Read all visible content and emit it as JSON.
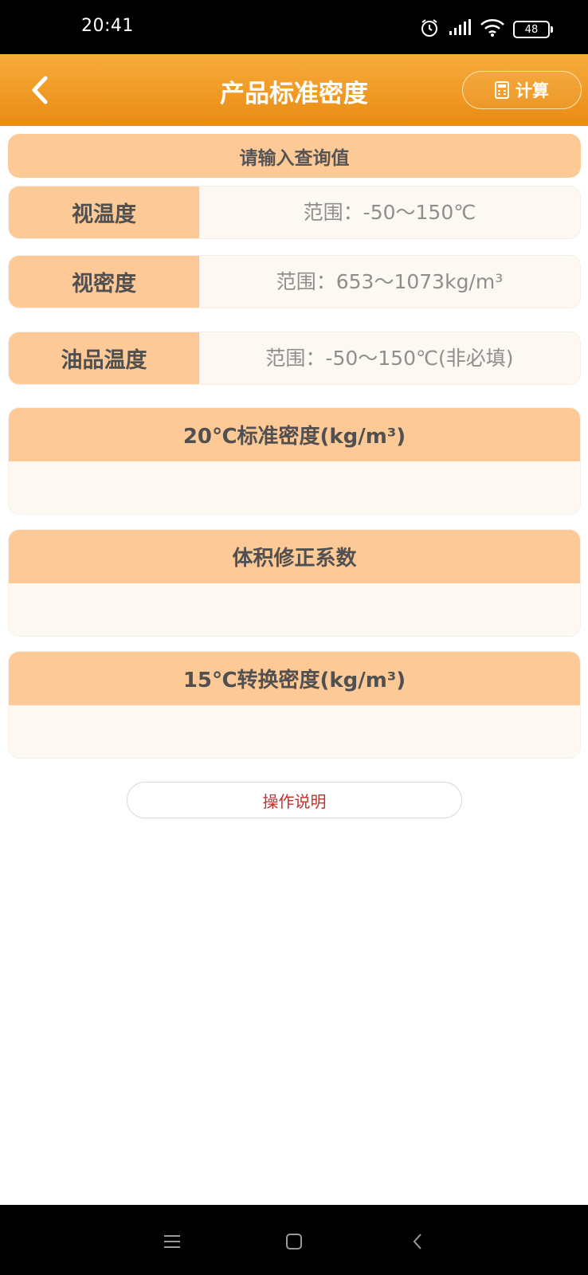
{
  "status": {
    "time": "20:41",
    "battery": "48"
  },
  "header": {
    "title": "产品标准密度",
    "calc_label": "计算"
  },
  "query": {
    "title": "请输入查询值"
  },
  "inputs": [
    {
      "label": "视温度",
      "placeholder": "范围：-50～150℃",
      "value": ""
    },
    {
      "label": "视密度",
      "placeholder": "范围：653～1073kg/m³",
      "value": ""
    },
    {
      "label": "油品温度",
      "placeholder": "范围：-50～150℃(非必填)",
      "value": ""
    }
  ],
  "results": [
    {
      "title": "20℃标准密度(kg/m³)",
      "value": ""
    },
    {
      "title": "体积修正系数",
      "value": ""
    },
    {
      "title": "15℃转换密度(kg/m³)",
      "value": ""
    }
  ],
  "help": {
    "label": "操作说明"
  },
  "colors": {
    "header": "#f29a24",
    "label_bg": "#fdc997",
    "field_bg": "#fdf9f2",
    "help_text": "#c0332a"
  }
}
